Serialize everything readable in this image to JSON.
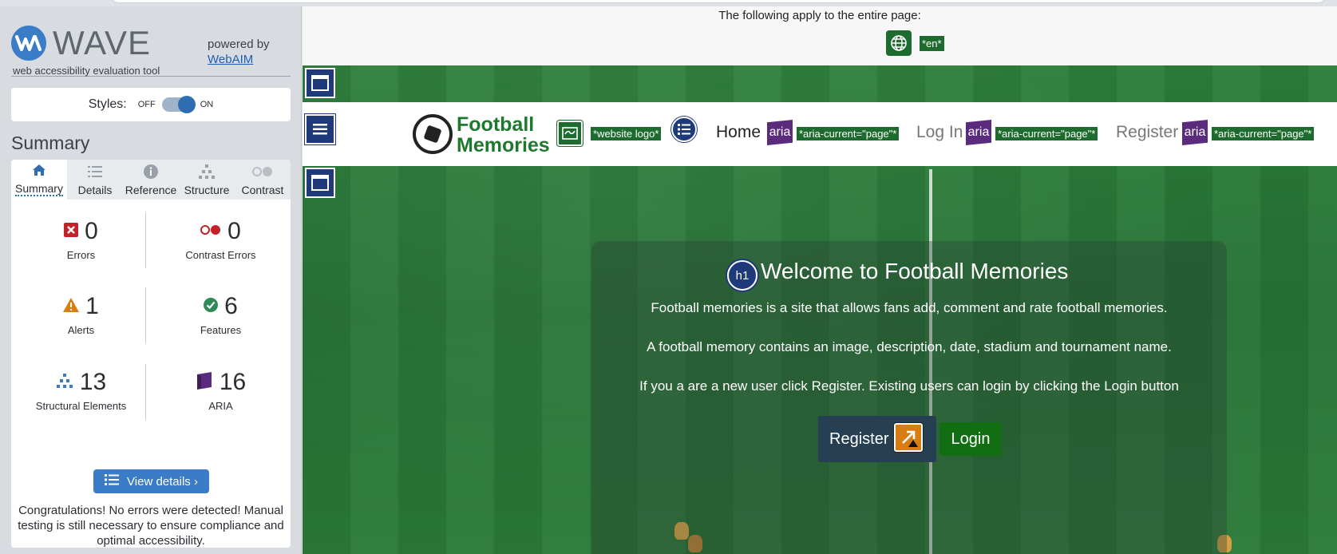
{
  "wave": {
    "logo_word": "WAVE",
    "tagline": "web accessibility evaluation tool",
    "powered_by": "powered by",
    "webaim_link": "WebAIM",
    "styles_label": "Styles:",
    "toggle_off": "OFF",
    "toggle_on": "ON",
    "summary_title": "Summary",
    "tabs": [
      {
        "label": "Summary",
        "icon": "home-icon",
        "active": true
      },
      {
        "label": "Details",
        "icon": "list-icon"
      },
      {
        "label": "Reference",
        "icon": "info-icon"
      },
      {
        "label": "Structure",
        "icon": "structure-icon"
      },
      {
        "label": "Contrast",
        "icon": "contrast-icon"
      }
    ],
    "stats": [
      {
        "label": "Errors",
        "value": "0",
        "icon": "error-icon",
        "color": "#c4222a"
      },
      {
        "label": "Contrast Errors",
        "value": "0",
        "icon": "contrast-error-icon",
        "color": "#c4222a"
      },
      {
        "label": "Alerts",
        "value": "1",
        "icon": "alert-icon",
        "color": "#d77d12"
      },
      {
        "label": "Features",
        "value": "6",
        "icon": "feature-check-icon",
        "color": "#2e8b57"
      },
      {
        "label": "Structural Elements",
        "value": "13",
        "icon": "structure-icon",
        "color": "#3a7cc6"
      },
      {
        "label": "ARIA",
        "value": "16",
        "icon": "aria-cube-icon",
        "color": "#5b2b7e"
      }
    ],
    "view_details": "View details ›",
    "congrats": "Congratulations! No errors were detected! Manual testing is still necessary to ensure compliance and optimal accessibility."
  },
  "page": {
    "apply_text": "The following apply to the entire page:",
    "lang_tag": "*en*",
    "brand_line1": "Football",
    "brand_line2": "Memories",
    "logo_alt_tag": "*website logo*",
    "nav": [
      {
        "label": "Home",
        "aria_tag": "*aria-current=\"page\"*"
      },
      {
        "label": "Log In",
        "aria_tag": "*aria-current=\"page\"*"
      },
      {
        "label": "Register",
        "aria_tag": "*aria-current=\"page\"*"
      }
    ],
    "aria_badge": "aria",
    "h1_badge": "h1",
    "title": "Welcome to Football Memories",
    "paragraphs": [
      "Football memories is a site that allows fans add, comment and rate football memories.",
      "A football memory contains an image, description, date, stadium and tournament name.",
      "If you a are a new user click Register. Existing users can login by clicking the Login button"
    ],
    "register_btn": "Register",
    "login_btn": "Login"
  },
  "colors": {
    "wave_blue": "#3a7cc6",
    "wave_green_tag": "#1d6b2e",
    "aria_purple": "#5b2b7e",
    "structure_navy": "#1f3a7a",
    "brand_green": "#1d7a2c",
    "login_green": "#126e13"
  }
}
